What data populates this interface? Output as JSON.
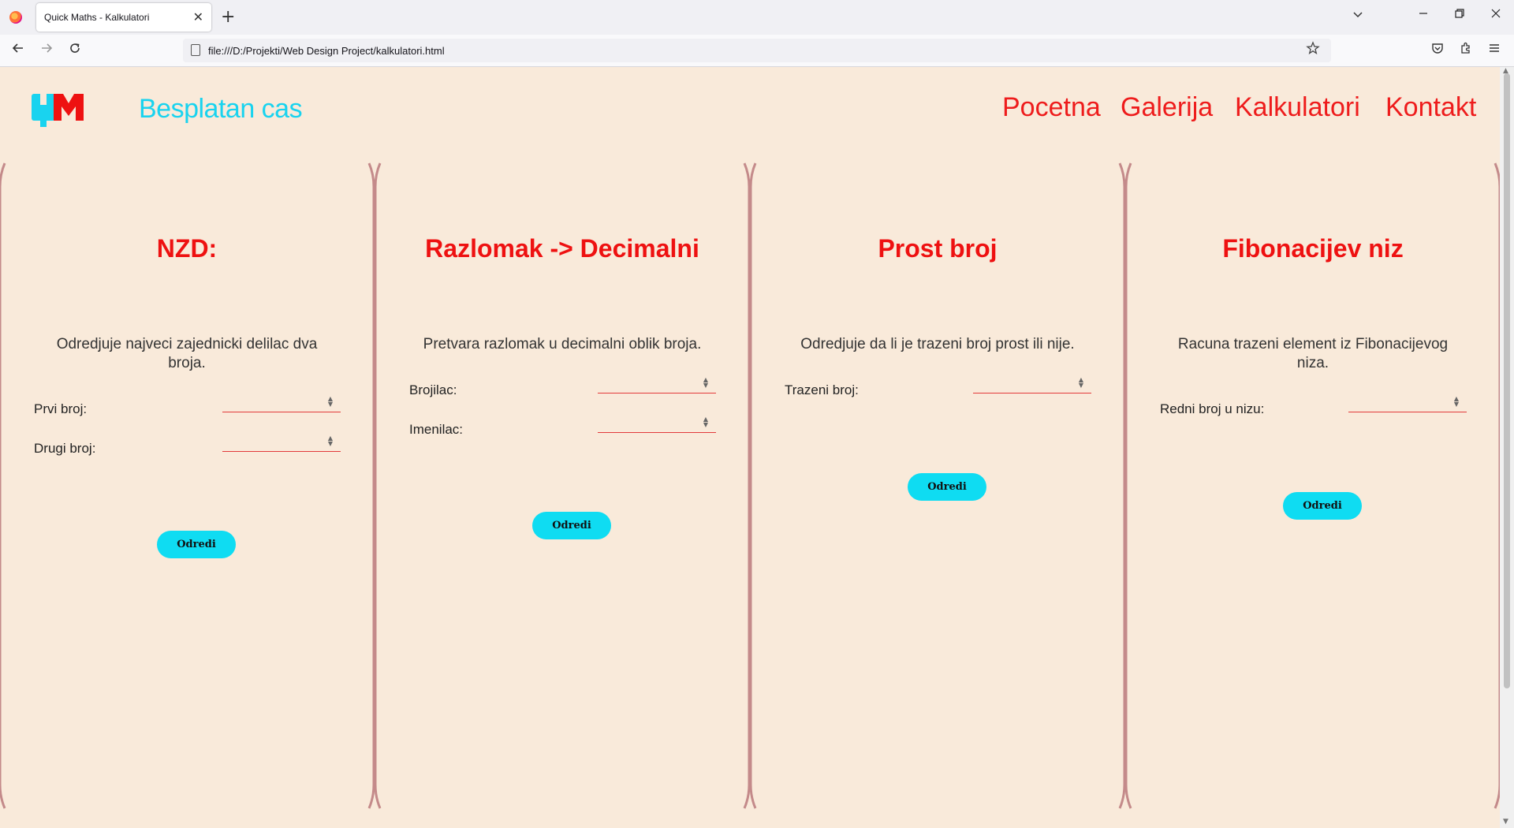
{
  "browser": {
    "tab_title": "Quick Maths - Kalkulatori",
    "tab_close": "✕",
    "new_tab": "+",
    "url": "file:///D:/Projekti/Web Design Project/kalkulatori.html",
    "icons": [
      "firefox-logo-icon",
      "back-arrow-icon",
      "forward-arrow-icon",
      "reload-icon",
      "page-icon",
      "bookmark-star-icon",
      "pocket-icon",
      "extensions-icon",
      "menu-icon",
      "tab-list-icon",
      "minimize-icon",
      "restore-icon",
      "close-window-icon"
    ]
  },
  "header": {
    "brand": "Besplatan cas",
    "nav": [
      "Pocetna",
      "Galerija",
      "Kalkulatori",
      "Kontakt"
    ]
  },
  "cards": [
    {
      "title": "NZD:",
      "description": "Odredjuje najveci zajednicki delilac dva broja.",
      "fields": [
        "Prvi broj:",
        "Drugi broj:"
      ],
      "button": "Odredi"
    },
    {
      "title": "Razlomak -> Decimalni",
      "description": "Pretvara razlomak u decimalni oblik broja.",
      "fields": [
        "Brojilac:",
        "Imenilac:"
      ],
      "button": "Odredi"
    },
    {
      "title": "Prost broj",
      "description": "Odredjuje da li je trazeni broj prost ili nije.",
      "fields": [
        "Trazeni broj:"
      ],
      "button": "Odredi"
    },
    {
      "title": "Fibonacijev niz",
      "description": "Racuna trazeni element iz Fibonacijevog niza.",
      "fields": [
        "Redni broj u nizu:"
      ],
      "button": "Odredi"
    }
  ],
  "colors": {
    "background": "#f9eada",
    "brand": "#19d3ef",
    "accent_red": "#ee1111",
    "button": "#0fdcf2",
    "card_border": "#c48a8a"
  }
}
